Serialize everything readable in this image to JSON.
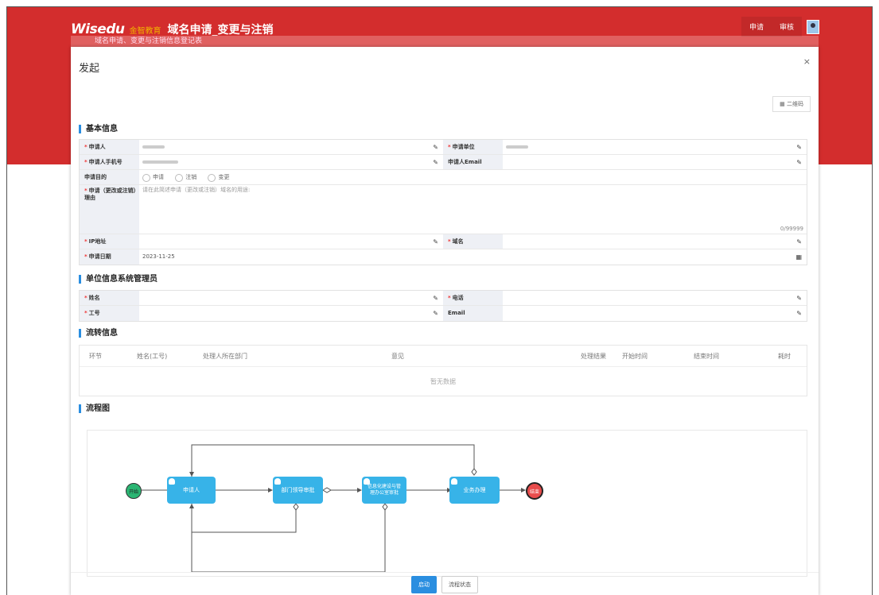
{
  "header": {
    "logo": "Wisedu",
    "logo_cn": "金智教育",
    "app_title": "域名申请_变更与注销",
    "subtitle": "域名申请、变更与注销信息登记表",
    "nav": [
      "申请",
      "审核"
    ]
  },
  "dialog": {
    "title": "发起",
    "close": "×",
    "qr_button": "▦ 二维码"
  },
  "basic": {
    "section": "基本信息",
    "applicant_label": "申请人",
    "unit_label": "申请单位",
    "phone_label": "申请人手机号",
    "email_label": "申请人Email",
    "purpose_label": "申请目的",
    "purpose_options": [
      "申请",
      "注销",
      "变更"
    ],
    "reason_label": "申请（更改或注销）理由",
    "reason_placeholder": "请在此简述申请（更改或注销）域名的用途:",
    "reason_counter": "0/99999",
    "ip_label": "IP地址",
    "domain_label": "域名",
    "date_label": "申请日期",
    "date_value": "2023-11-25"
  },
  "admin": {
    "section": "单位信息系统管理员",
    "name_label": "姓名",
    "phone_label": "电话",
    "id_label": "工号",
    "email_label": "Email"
  },
  "circulation": {
    "section": "流转信息",
    "columns": [
      "环节",
      "姓名(工号)",
      "处理人所在部门",
      "意见",
      "处理结果",
      "开始时间",
      "结束时间",
      "耗时"
    ],
    "empty": "暂无数据"
  },
  "flowchart": {
    "section": "流程图",
    "start": "开始",
    "end": "结束",
    "nodes": [
      "申请人",
      "部门领导审批",
      "信息化建设与管理办公室审批",
      "业务办理"
    ]
  },
  "footer": {
    "start_button": "启动",
    "status_button": "流程状态"
  },
  "colors": {
    "brand_red": "#d32d2d",
    "accent_blue": "#2a8ee0",
    "node_blue": "#37b3e8"
  }
}
